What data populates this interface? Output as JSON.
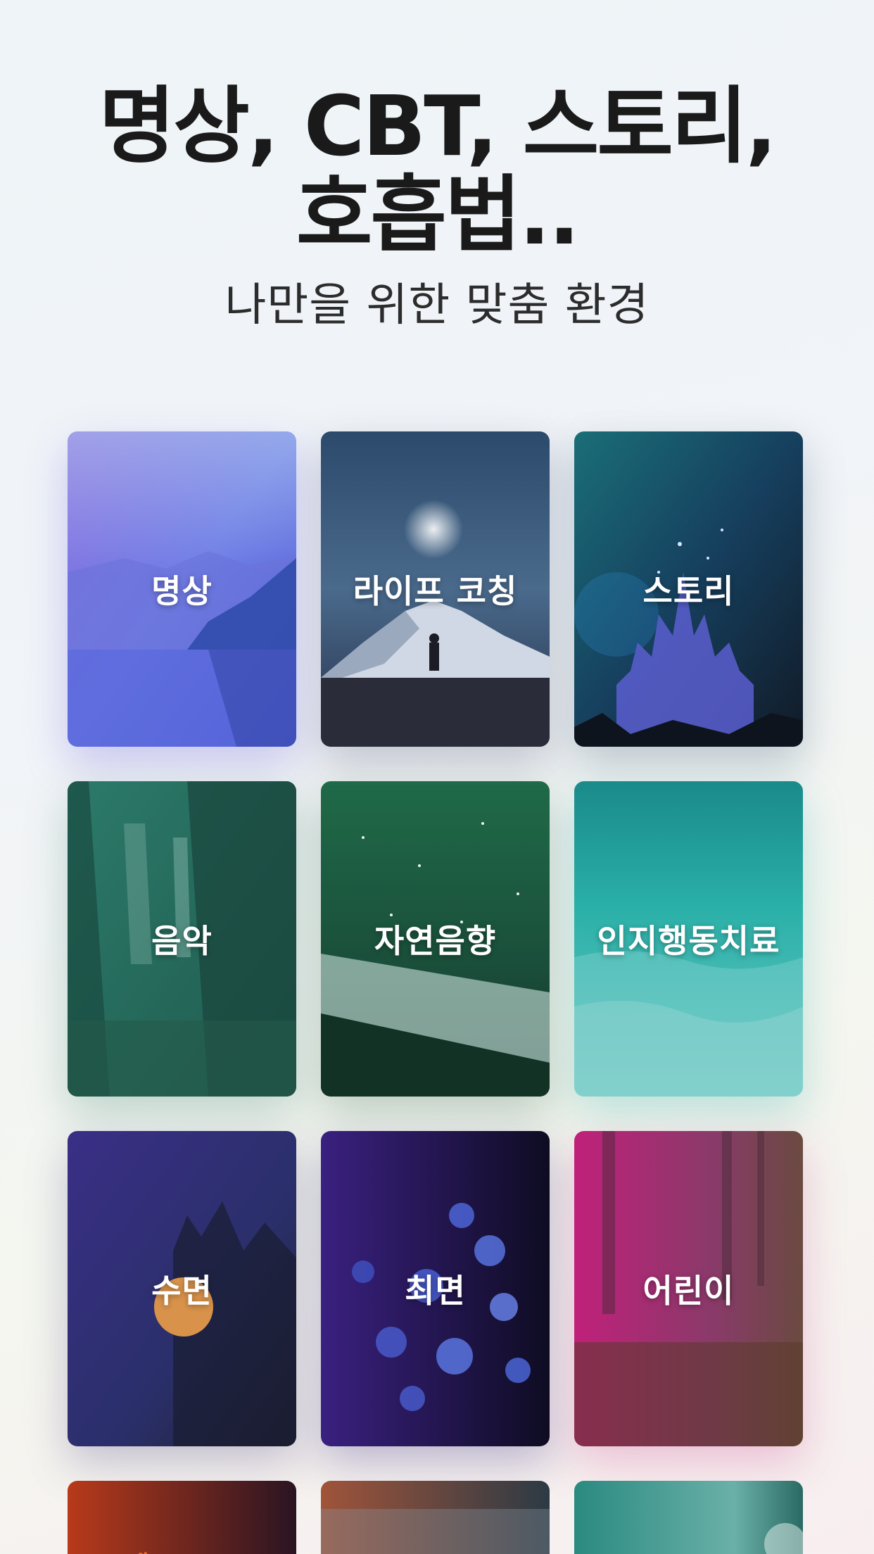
{
  "header": {
    "title_line1": "명상, CBT, 스토리,",
    "title_line2": "호흡법..",
    "subtitle": "나만을 위한 맞춤 환경"
  },
  "categories": [
    {
      "label": "명상"
    },
    {
      "label": "라이프 코칭"
    },
    {
      "label": "스토리"
    },
    {
      "label": "음악"
    },
    {
      "label": "자연음향"
    },
    {
      "label": "인지행동치료"
    },
    {
      "label": "수면"
    },
    {
      "label": "최면"
    },
    {
      "label": "어린이"
    }
  ]
}
